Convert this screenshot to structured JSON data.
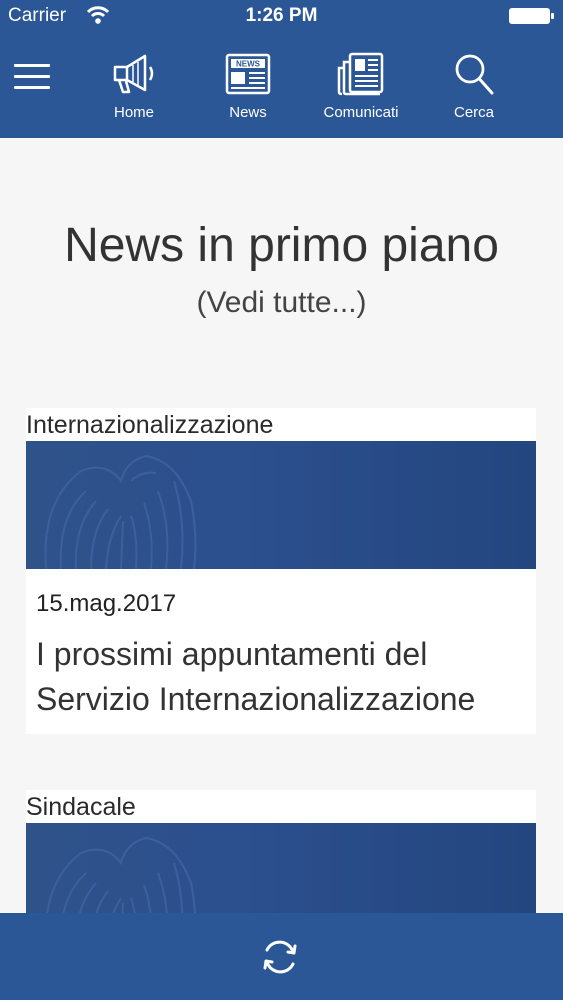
{
  "status": {
    "carrier": "Carrier",
    "time": "1:26 PM"
  },
  "nav": {
    "items": [
      {
        "label": "Home",
        "icon": "megaphone-icon"
      },
      {
        "label": "News",
        "icon": "newspaper-icon"
      },
      {
        "label": "Comunicati",
        "icon": "press-release-icon"
      },
      {
        "label": "Cerca",
        "icon": "search-icon"
      }
    ],
    "news_icon_text": "NEWS"
  },
  "main": {
    "headline": "News in primo piano",
    "see_all": "(Vedi tutte...)",
    "cards": [
      {
        "category": "Internazionalizzazione",
        "date": "15.mag.2017",
        "title": "I prossimi appuntamenti del Servizio Internazionalizzazione"
      },
      {
        "category": "Sindacale"
      }
    ]
  },
  "colors": {
    "brand": "#2b5797",
    "background": "#f6f6f6"
  }
}
